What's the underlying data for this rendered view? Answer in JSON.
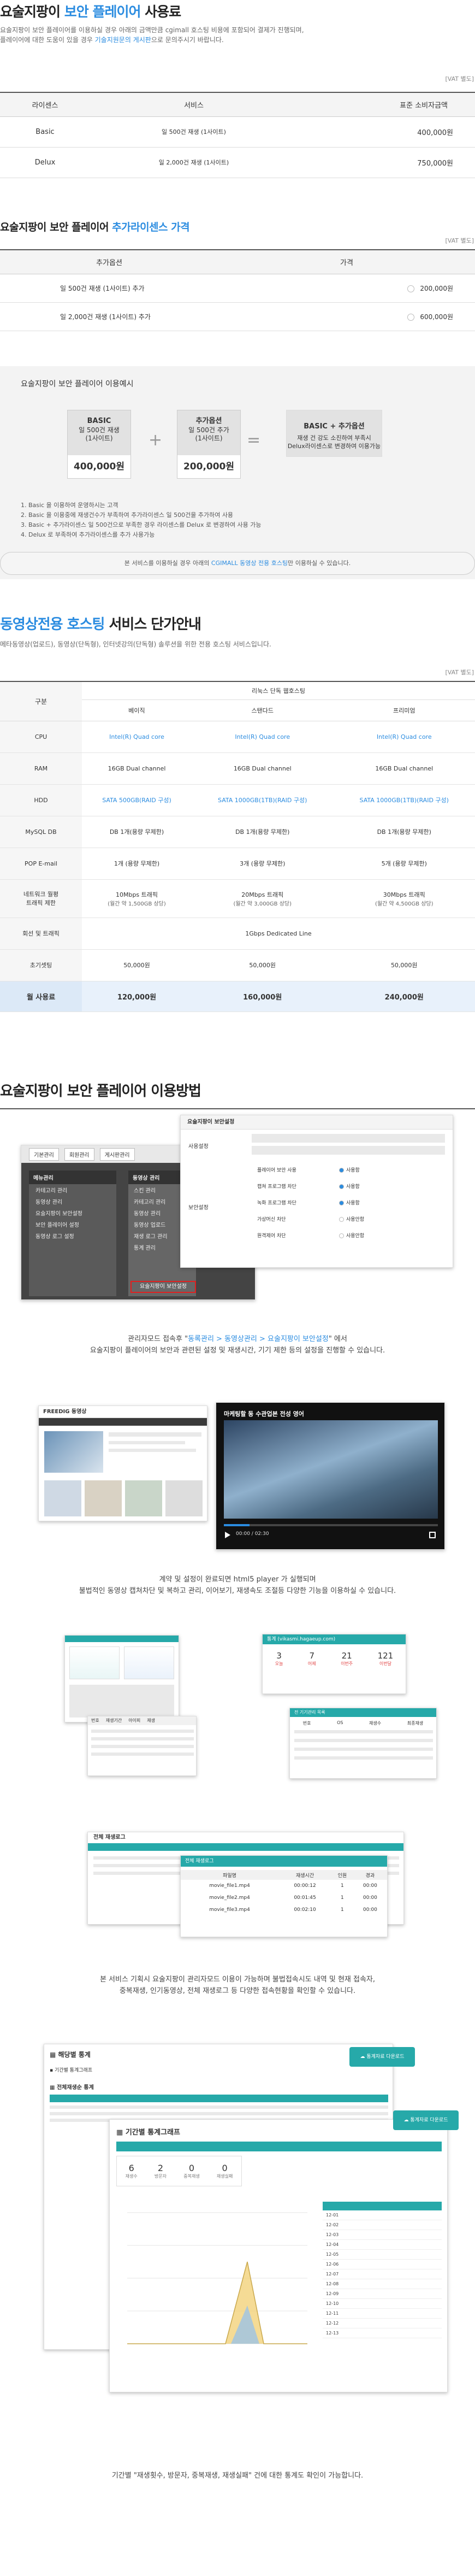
{
  "sec1": {
    "title_a": "요술지팡이",
    "title_b": "보안 플레이어",
    "title_c": "사용료",
    "desc1": "요술지팡이 보안 플레이어를 이용하실 경우 아래의 금액만큼 cgimall 호스팅 비용에 포함되어 결제가 진행되며,",
    "desc2a": "플레이어에 대한 도움이 있을 경우 ",
    "desc2b": "기술지원문의 게시판",
    "desc2c": "으로 문의주시기 바랍니다.",
    "vat": "[VAT 별도]",
    "headers": [
      "라이센스",
      "서비스",
      "표준 소비자금액"
    ],
    "rows": [
      {
        "license": "Basic",
        "service": "일 500건 재생 (1사이트)",
        "price": "400,000원"
      },
      {
        "license": "Delux",
        "service": "일 2,000건 재생 (1사이트)",
        "price": "750,000원"
      }
    ]
  },
  "sec2": {
    "title_a": "요술지팡이 보안 플레이어",
    "title_b": "추가라이센스 가격",
    "vat": "[VAT 별도]",
    "headers": [
      "추가옵션",
      "가격"
    ],
    "rows": [
      {
        "option": "일 500건 재생 (1사이트) 추가",
        "price": "200,000원"
      },
      {
        "option": "일 2,000건 재생 (1사이트) 추가",
        "price": "600,000원"
      }
    ]
  },
  "calc": {
    "title": "요술지팡이 보안 플레이어 이용예시",
    "box1": {
      "name": "BASIC",
      "l1": "일 500건 재생",
      "l2": "(1사이트)",
      "price": "400,000원"
    },
    "box2": {
      "name": "추가옵션",
      "l1": "일 500건 추가",
      "l2": "(1사이트)",
      "price": "200,000원"
    },
    "box3": {
      "name": "BASIC + 추가옵션",
      "l1": "재생 건 강도 소진하여 부족시",
      "l2": "Delux라이센스로 변경하여 이용가능"
    },
    "plus": "+",
    "eq": "=",
    "notes": [
      "1. Basic 을 이용하여 운영하시는 고객",
      "2. Basic 을 이용중에 재생건수가 부족하여 추가라이센스 일 500건을 추가하여 사용",
      "3. Basic + 추가라이센스 일 500건으로 부족한 경우 라이센스를 Delux 로 변경하여 사용 가능",
      "4. Delux 로 부족하여 추가라이센스를 추가 사용가능"
    ],
    "pill_a": "본 서비스를 이용하실 경우 아래의 ",
    "pill_b": "CGIMALL 동영상 전용 호스팅",
    "pill_c": "만 이용하실 수 있습니다."
  },
  "sec3": {
    "title_a": "동영상전용 호스팅",
    "title_b": "서비스 단가안내",
    "desc": "메타동영상(업로드), 동영상(단독형), 인터넷강의(단독형) 솔루션을 위한 전용 호스팅 서비스입니다.",
    "vat": "[VAT 별도]",
    "group_label": "구분",
    "group_header": "리눅스 단독 웹호스팅",
    "plans": [
      "베이직",
      "스탠다드",
      "프리미엄"
    ],
    "rows": [
      {
        "label": "CPU",
        "vals": [
          "Intel(R) Quad core",
          "Intel(R) Quad core",
          "Intel(R) Quad core"
        ],
        "blue": true
      },
      {
        "label": "RAM",
        "vals": [
          "16GB Dual channel",
          "16GB Dual channel",
          "16GB Dual channel"
        ]
      },
      {
        "label": "HDD",
        "vals": [
          "SATA 500GB(RAID 구성)",
          "SATA 1000GB(1TB)(RAID 구성)",
          "SATA 1000GB(1TB)(RAID 구성)"
        ],
        "blue": true
      },
      {
        "label": "MySQL DB",
        "vals": [
          "DB 1개(용량 무제한)",
          "DB 1개(용량 무제한)",
          "DB 1개(용량 무제한)"
        ]
      },
      {
        "label": "POP E-mail",
        "vals": [
          "1개 (용량 무제한)",
          "3개 (용량 무제한)",
          "5개 (용량 무제한)"
        ]
      }
    ],
    "traffic_label1": "네트워크 월평",
    "traffic_label2": "트래픽 제한",
    "traffic": [
      {
        "a": "10Mbps 트래픽",
        "b": "(월간 약 1,500GB 상당)"
      },
      {
        "a": "20Mbps 트래픽",
        "b": "(월간 약 3,000GB 상당)"
      },
      {
        "a": "30Mbps 트래픽",
        "b": "(월간 약 4,500GB 상당)"
      }
    ],
    "line_label": "회선 및 트래픽",
    "line_value": "1Gbps Dedicated Line",
    "setup_label": "초기셋팅",
    "setup": [
      "50,000원",
      "50,000원",
      "50,000원"
    ],
    "price_label": "월 사용료",
    "prices": [
      "120,000원",
      "160,000원",
      "240,000원"
    ]
  },
  "sec4": {
    "title": "요술지팡이 보안 플레이어 이용방법",
    "shot1": {
      "tabs": [
        "기본관리",
        "회원관리",
        "게시판관리"
      ],
      "menu_title": "메뉴관리",
      "menu_title2": "동영상 관리",
      "menu_items": [
        "카테고리 관리",
        "동영상 관리",
        "요술지팡이 보안설정",
        "보안 플레이어 설정",
        "동영상 로그 설정"
      ],
      "right_items": [
        "스킨 관리",
        "카테고리 관리",
        "동영상 관리",
        "동영상 업로드",
        "재생 로그 관리",
        "통계 관리",
        "요술지팡이 보안설정"
      ],
      "highlight": "요술지팡이 보안설정",
      "panel_title": "요술지팡이 보안설정",
      "panel_label": "사용설정",
      "panel_label2": "보안설정",
      "opts": [
        "플레이어 보안 사용",
        "캡쳐 프로그램 차단",
        "녹화 프로그램 차단",
        "가상머신 차단",
        "원격제어 차단"
      ],
      "radio_use": "사용함",
      "radio_unuse": "사용안함"
    },
    "caption1_a": "관리자모드 접속후 \"",
    "caption1_b": "동록관리 > 동영상관리 > 요술지팡이 보안설정",
    "caption1_c": "\" 에서",
    "caption1_2": "요술지팡이 플레이어의 보안과 관련된 설정 및 재생시간, 기기 제한 등의 설정을 진행할 수 있습니다.",
    "shot2": {
      "brand": "FREEDIG 동영상",
      "video_title": "마케팅할 동 수관업본 전성 영어",
      "time": "00:00 / 02:30"
    },
    "caption2_1": "계약 및 설정이 완료되면 html5 player 가 실행되며",
    "caption2_2": "불법적인 동영상 캡쳐차단 및 복하고 관리, 이어보기, 재생속도 조절등 다양한 기능을 이용하실 수 있습니다.",
    "shot3": {
      "stats_title": "통계 (vikasmi.hagaeup.com)",
      "stat_nums": [
        "3",
        "7",
        "21",
        "121"
      ],
      "stat_labels": [
        "오늘",
        "어제",
        "이번주",
        "이번달"
      ],
      "list_title": "전체 재생로그",
      "col": [
        "번호",
        "재생기간",
        "아이피",
        "재생",
        "접속"
      ],
      "popup_title": "전체 재생로그",
      "popup_cols": [
        "파일명",
        "재생시간",
        "인원",
        "경과"
      ],
      "popup_rows": [
        [
          "movie_file1.mp4",
          "00:00:12",
          "1",
          "00:00"
        ],
        [
          "movie_file2.mp4",
          "00:01:45",
          "1",
          "00:00"
        ],
        [
          "movie_file3.mp4",
          "00:02:10",
          "1",
          "00:00"
        ]
      ],
      "device_title": "전 기기관리 목록",
      "device_cols": [
        "번호",
        "OS",
        "재생수",
        "최종재생"
      ]
    },
    "caption3_1": "본 서비스 기획시 요술지팡이 관리자모드 이용이 가능하며 불법접속시도 내역 및 현재 접속자,",
    "caption3_2": "중복재생, 인기동영상, 전체 재생로그 등 다양한 접속현황을 확인할 수 있습니다.",
    "shot4": {
      "stat_title": "해당별 통계",
      "btn": "통계자료 다운로드",
      "period": "기간별 통계그래프",
      "period_title": "기간별 통계그래프",
      "cat_title": "전체재생순 통계",
      "sum_nums": [
        "6",
        "2",
        "0",
        "0"
      ],
      "sum_labels": [
        "재생수",
        "방문자",
        "중복재생",
        "재생실패"
      ],
      "dates": [
        "12-01",
        "12-02",
        "12-03",
        "12-04",
        "12-05",
        "12-06",
        "12-07",
        "12-08",
        "12-09",
        "12-10",
        "12-11",
        "12-12",
        "12-13"
      ]
    },
    "caption4": "기간별 \"재생횟수, 방문자, 중복재생, 재생실패\" 건에 대한 통계도 확인이 가능합니다."
  }
}
